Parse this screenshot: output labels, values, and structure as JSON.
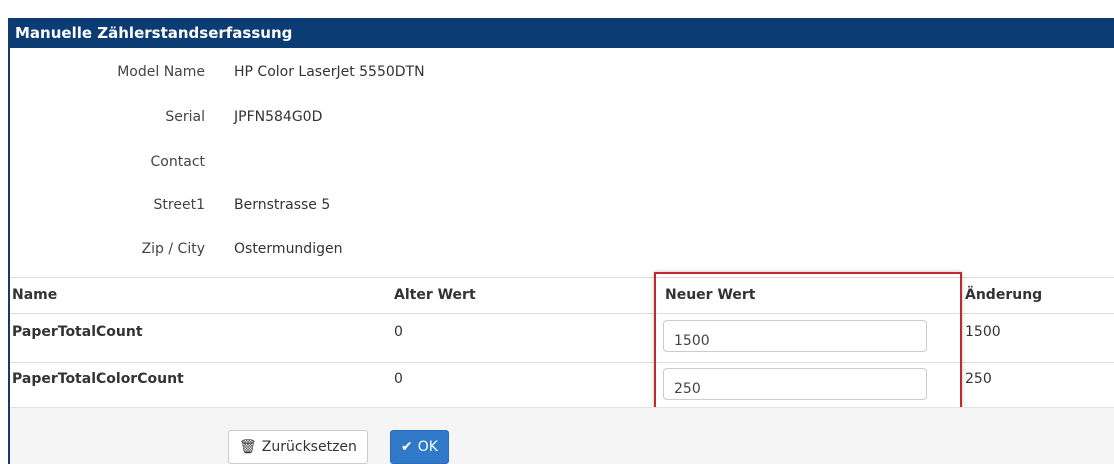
{
  "dialog": {
    "title": "Manuelle Zählerstandserfassung"
  },
  "info": [
    {
      "label": "Model Name",
      "value": "HP Color LaserJet 5550DTN"
    },
    {
      "label": "Serial",
      "value": "JPFN584G0D"
    },
    {
      "label": "Contact",
      "value": ""
    },
    {
      "label": "Street1",
      "value": "Bernstrasse 5"
    },
    {
      "label": "Zip / City",
      "value": "Ostermundigen"
    }
  ],
  "table": {
    "headers": {
      "name": "Name",
      "old": "Alter Wert",
      "new": "Neuer Wert",
      "change": "Änderung"
    },
    "rows": [
      {
        "name": "PaperTotalCount",
        "old": "0",
        "new": "1500",
        "change": "1500"
      },
      {
        "name": "PaperTotalColorCount",
        "old": "0",
        "new": "250",
        "change": "250"
      }
    ]
  },
  "buttons": {
    "reset": "Zurücksetzen",
    "ok": "OK"
  },
  "icons": {
    "reset": "trash-icon",
    "ok": "checkmark-icon"
  },
  "colors": {
    "header_bg": "#0b3c73",
    "highlight": "#c0282d",
    "ok_button": "#3079c9"
  }
}
